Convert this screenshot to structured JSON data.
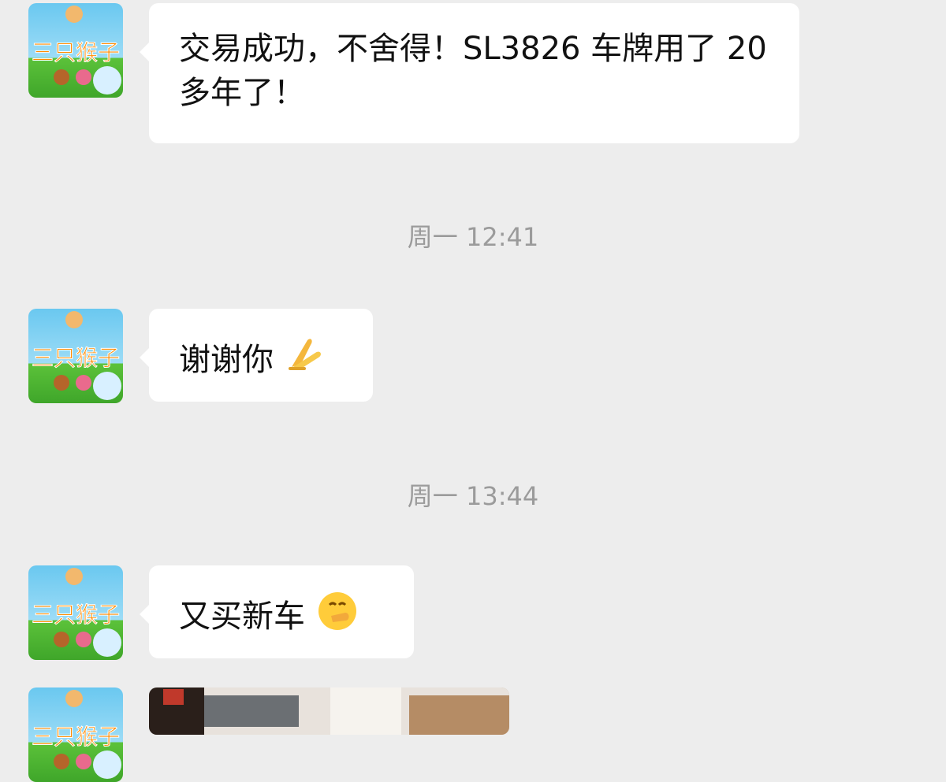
{
  "conversation": {
    "messages": [
      {
        "type": "text",
        "text": "交易成功，不舍得！SL3826 车牌用了 20 多年了！"
      },
      {
        "type": "time",
        "text": "周一 12:41"
      },
      {
        "type": "text",
        "text": "谢谢你",
        "emoji": "folded-hands-emoji"
      },
      {
        "type": "time",
        "text": "周一 13:44"
      },
      {
        "type": "text",
        "text": "又买新车",
        "emoji": "face-with-hand-over-mouth-emoji"
      },
      {
        "type": "image",
        "content": "car-photo"
      }
    ],
    "avatar": {
      "label": "三只猴子"
    }
  },
  "colors": {
    "background": "#ededed",
    "bubble": "#ffffff",
    "timestamp": "#9b9b9b"
  }
}
